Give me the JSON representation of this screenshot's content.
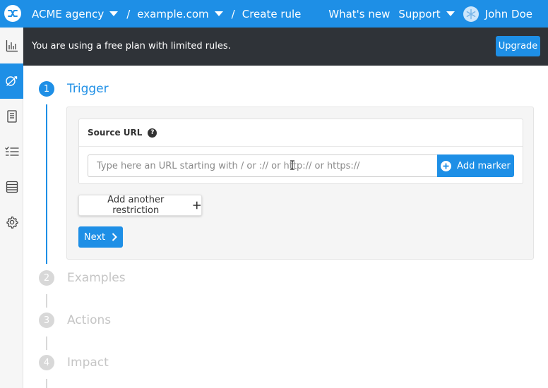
{
  "header": {
    "breadcrumbs": [
      {
        "label": "ACME agency",
        "dropdown": true
      },
      {
        "label": "example.com",
        "dropdown": true
      },
      {
        "label": "Create rule",
        "dropdown": false
      }
    ],
    "separator": "/",
    "whats_new": "What's new",
    "support": "Support",
    "user_name": "John Doe"
  },
  "sidebar": {
    "items": [
      {
        "icon": "bar-chart-icon",
        "active": false
      },
      {
        "icon": "rules-icon",
        "active": true
      },
      {
        "icon": "document-icon",
        "active": false
      },
      {
        "icon": "checklist-icon",
        "active": false
      },
      {
        "icon": "database-icon",
        "active": false
      },
      {
        "icon": "gear-icon",
        "active": false
      }
    ]
  },
  "banner": {
    "message": "You are using a free plan with limited rules.",
    "upgrade_label": "Upgrade"
  },
  "steps": [
    {
      "number": "1",
      "label": "Trigger",
      "active": true
    },
    {
      "number": "2",
      "label": "Examples",
      "active": false
    },
    {
      "number": "3",
      "label": "Actions",
      "active": false
    },
    {
      "number": "4",
      "label": "Impact",
      "active": false
    }
  ],
  "trigger": {
    "source_url_label": "Source URL",
    "help_glyph": "?",
    "url_value": "",
    "url_placeholder": "Type here an URL starting with / or :// or http:// or https://",
    "add_marker_label": "Add marker",
    "add_restriction_label": "Add another restriction",
    "next_label": "Next"
  },
  "colors": {
    "accent": "#1e8fe6",
    "banner_bg": "#2f3338",
    "inactive_step": "#d8d8d8"
  }
}
